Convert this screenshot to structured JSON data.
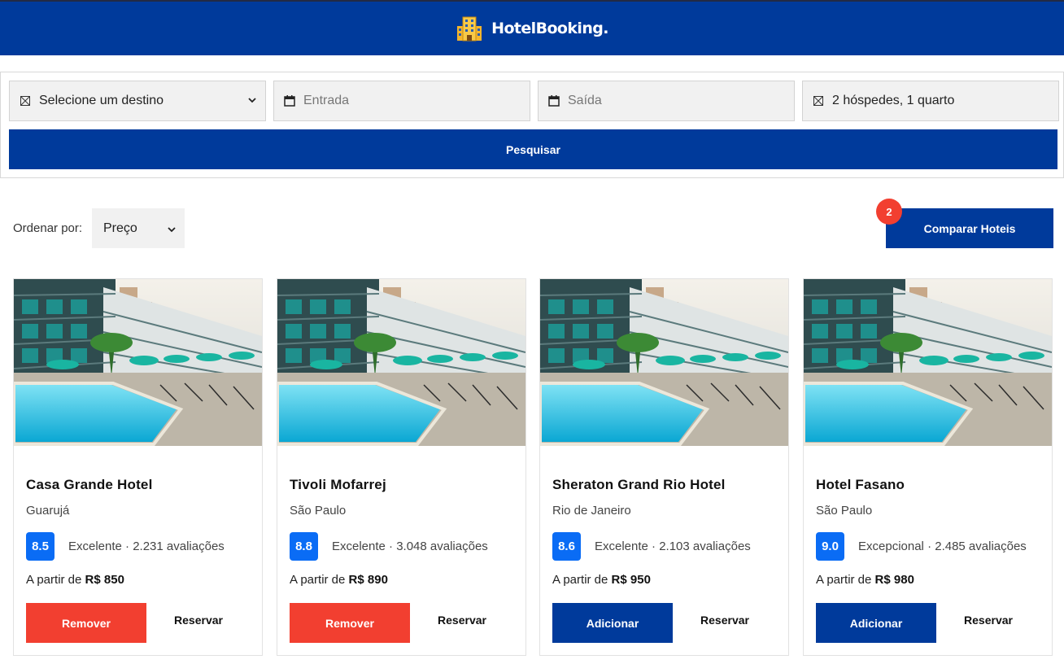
{
  "brand": {
    "name": "HotelBooking."
  },
  "search": {
    "destination": {
      "value": "Selecione um destino"
    },
    "checkin": {
      "placeholder": "Entrada"
    },
    "checkout": {
      "placeholder": "Saída"
    },
    "guests": {
      "value": "2 hóspedes, 1 quarto"
    },
    "button_label": "Pesquisar"
  },
  "sort": {
    "label": "Ordenar por:",
    "selected": "Preço"
  },
  "compare": {
    "label": "Comparar Hoteis",
    "count": "2"
  },
  "hotels": [
    {
      "name": "Casa Grande Hotel",
      "city": "Guarujá",
      "score": "8.5",
      "rating": "Excelente",
      "reviews": "· 2.231 avaliações",
      "price_prefix": "A partir de",
      "price": "R$ 850",
      "action_label": "Remover",
      "action_color": "#f23f30",
      "reserve_label": "Reservar"
    },
    {
      "name": "Tivoli Mofarrej",
      "city": "São Paulo",
      "score": "8.8",
      "rating": "Excelente",
      "reviews": "· 3.048 avaliações",
      "price_prefix": "A partir de",
      "price": "R$ 890",
      "action_label": "Remover",
      "action_color": "#f23f30",
      "reserve_label": "Reservar"
    },
    {
      "name": "Sheraton Grand Rio Hotel",
      "city": "Rio de Janeiro",
      "score": "8.6",
      "rating": "Excelente",
      "reviews": "· 2.103 avaliações",
      "price_prefix": "A partir de",
      "price": "R$ 950",
      "action_label": "Adicionar",
      "action_color": "#003a9b",
      "reserve_label": "Reservar"
    },
    {
      "name": "Hotel Fasano",
      "city": "São Paulo",
      "score": "9.0",
      "rating": "Excepcional",
      "reviews": "· 2.485 avaliações",
      "price_prefix": "A partir de",
      "price": "R$ 980",
      "action_label": "Adicionar",
      "action_color": "#003a9b",
      "reserve_label": "Reservar"
    }
  ],
  "colors": {
    "primary": "#003a9b",
    "danger": "#f23f30",
    "score": "#0a6cf5"
  }
}
